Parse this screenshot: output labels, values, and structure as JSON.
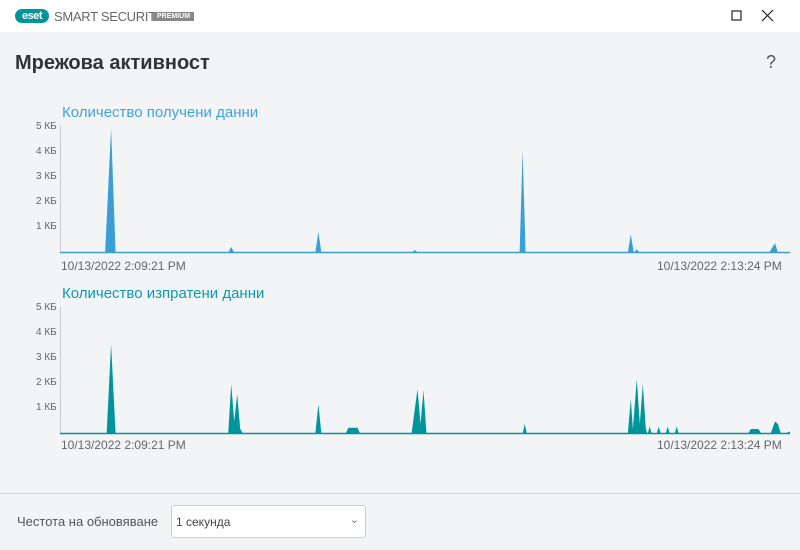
{
  "app": {
    "logo": "eset",
    "product": "SMART SECURITY",
    "edition": "PREMIUM"
  },
  "page": {
    "title": "Мрежова активност",
    "help": "?"
  },
  "charts": [
    {
      "title": "Количество получени данни",
      "color": "#3b9fd6",
      "title_color": "#3ea3dc",
      "yticks": [
        "1 КБ",
        "2 КБ",
        "3 КБ",
        "4 КБ",
        "5 КБ"
      ],
      "start": "10/13/2022 2:09:21 PM",
      "end": "10/13/2022 2:13:24 PM"
    },
    {
      "title": "Количество изпратени данни",
      "color": "#00959a",
      "title_color": "#0a9aae",
      "yticks": [
        "1 КБ",
        "2 КБ",
        "3 КБ",
        "4 КБ",
        "5 КБ"
      ],
      "start": "10/13/2022 2:09:21 PM",
      "end": "10/13/2022 2:13:24 PM"
    }
  ],
  "chart_data": [
    {
      "type": "area",
      "title": "Количество получени данни",
      "x_unit": "seconds from 2:09:21 PM",
      "y_unit": "KB",
      "xlim": [
        0,
        243
      ],
      "ylim": [
        0,
        5
      ],
      "points": [
        [
          0,
          0
        ],
        [
          15,
          0
        ],
        [
          17,
          5.0
        ],
        [
          18.5,
          0
        ],
        [
          56,
          0
        ],
        [
          57,
          0.25
        ],
        [
          58,
          0
        ],
        [
          85,
          0
        ],
        [
          86,
          0.85
        ],
        [
          87,
          0
        ],
        [
          117,
          0
        ],
        [
          118,
          0.12
        ],
        [
          119.5,
          0
        ],
        [
          153,
          0
        ],
        [
          154,
          4.1
        ],
        [
          155,
          0
        ],
        [
          189,
          0
        ],
        [
          190,
          0.75
        ],
        [
          191,
          0
        ],
        [
          192,
          0.15
        ],
        [
          193,
          0
        ],
        [
          236,
          0
        ],
        [
          238,
          0.4
        ],
        [
          239,
          0
        ],
        [
          243,
          0
        ]
      ]
    },
    {
      "type": "area",
      "title": "Количество изпратени данни",
      "x_unit": "seconds from 2:09:21 PM",
      "y_unit": "KB",
      "xlim": [
        0,
        243
      ],
      "ylim": [
        0,
        5
      ],
      "points": [
        [
          0,
          0
        ],
        [
          15.5,
          0
        ],
        [
          17,
          3.6
        ],
        [
          18.5,
          0
        ],
        [
          56,
          0
        ],
        [
          57,
          2.0
        ],
        [
          58,
          0.5
        ],
        [
          59,
          1.6
        ],
        [
          60,
          0.2
        ],
        [
          61,
          0
        ],
        [
          85,
          0
        ],
        [
          86,
          1.2
        ],
        [
          87,
          0
        ],
        [
          95,
          0
        ],
        [
          96,
          0.25
        ],
        [
          99,
          0.25
        ],
        [
          100,
          0
        ],
        [
          117,
          0
        ],
        [
          119,
          1.8
        ],
        [
          120,
          0.4
        ],
        [
          121,
          1.75
        ],
        [
          122,
          0
        ],
        [
          154,
          0
        ],
        [
          154.7,
          0.4
        ],
        [
          155.5,
          0
        ],
        [
          189,
          0
        ],
        [
          190,
          1.4
        ],
        [
          190.7,
          0.2
        ],
        [
          192,
          2.2
        ],
        [
          193,
          0.4
        ],
        [
          194,
          2.0
        ],
        [
          195,
          0.2
        ],
        [
          195.6,
          0
        ],
        [
          196.3,
          0.3
        ],
        [
          197,
          0
        ],
        [
          198.6,
          0
        ],
        [
          199.3,
          0.3
        ],
        [
          200,
          0
        ],
        [
          201.6,
          0
        ],
        [
          202.3,
          0.3
        ],
        [
          203,
          0
        ],
        [
          204.6,
          0
        ],
        [
          205.3,
          0.3
        ],
        [
          206,
          0
        ],
        [
          229,
          0
        ],
        [
          230,
          0.2
        ],
        [
          232.5,
          0.2
        ],
        [
          233.5,
          0
        ],
        [
          236.5,
          0
        ],
        [
          238,
          0.5
        ],
        [
          239,
          0.4
        ],
        [
          240,
          0
        ],
        [
          241,
          0
        ],
        [
          243,
          0.1
        ]
      ]
    }
  ],
  "footer": {
    "label": "Честота на обновяване",
    "select_value": "1 секунда"
  }
}
